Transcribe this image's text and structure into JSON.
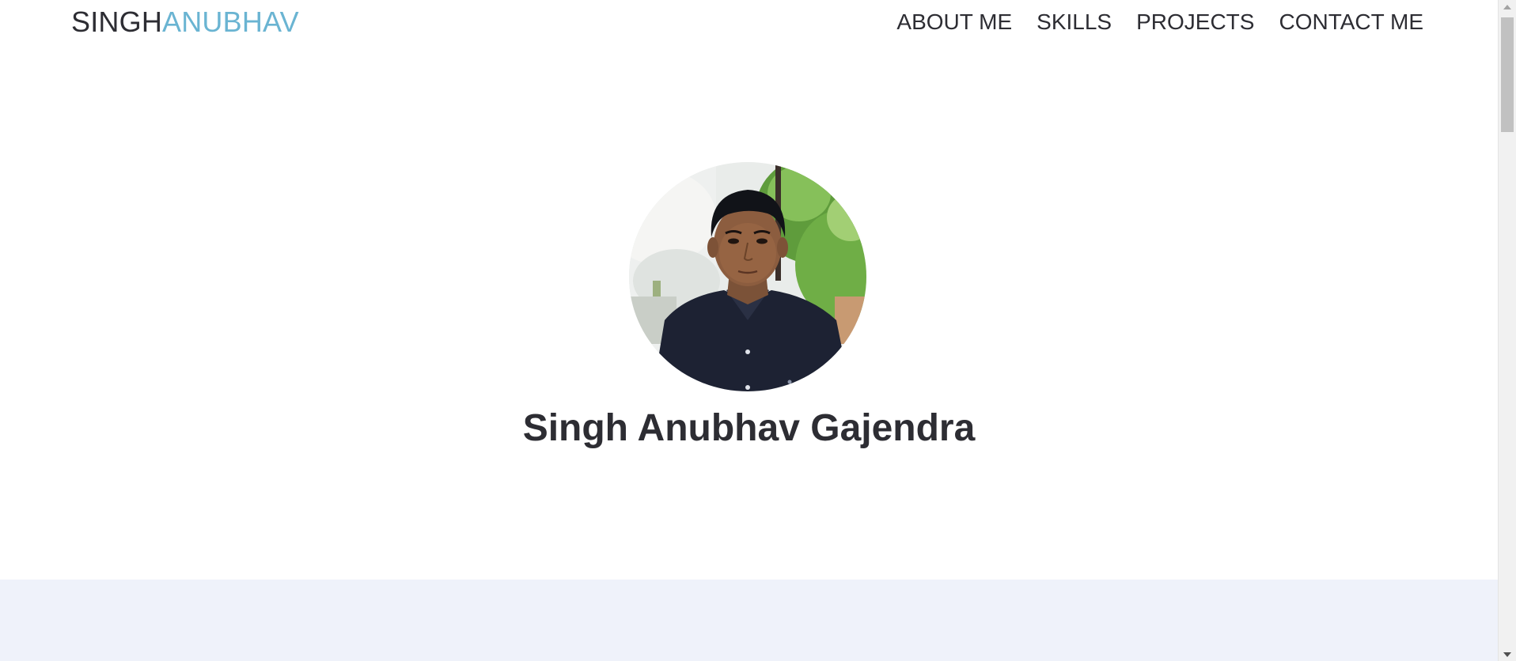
{
  "navbar": {
    "brand_first": "SINGH",
    "brand_second": "ANUBHAV",
    "links": [
      {
        "label": "ABOUT ME"
      },
      {
        "label": "SKILLS"
      },
      {
        "label": "PROJECTS"
      },
      {
        "label": "CONTACT ME"
      }
    ]
  },
  "hero": {
    "name": "Singh Anubhav Gajendra",
    "avatar_icon": "profile-photo"
  },
  "colors": {
    "text": "#2d2d33",
    "brand_accent": "#6ab4d2",
    "next_section_bg": "#eff2fa"
  },
  "scrollbar": {
    "up_icon": "arrow-up-icon",
    "down_icon": "arrow-down-icon"
  }
}
